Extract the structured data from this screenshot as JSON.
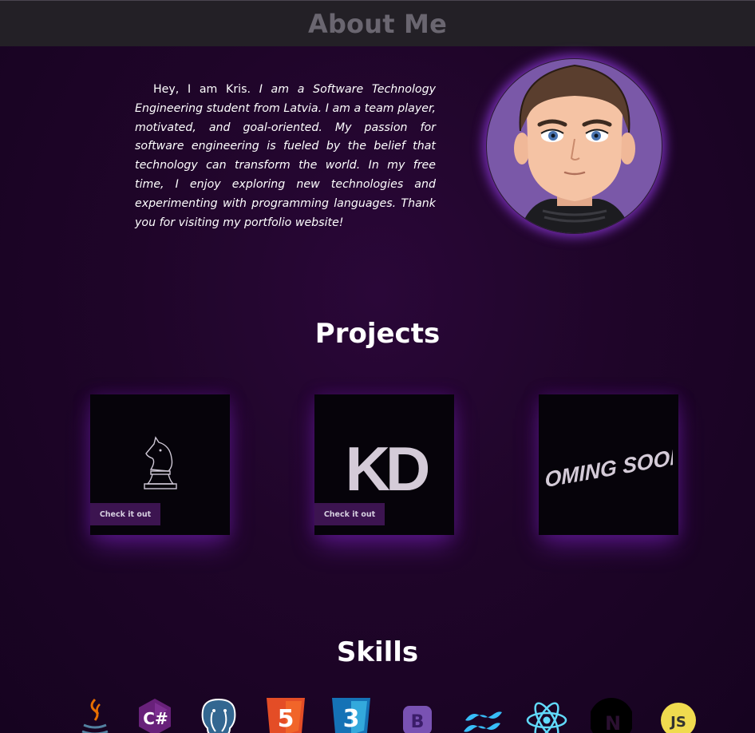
{
  "header": {
    "title": "About Me"
  },
  "about": {
    "bio_lead": "Hey, I am Kris.",
    "bio_rest": "I am a Software Technology Engineering student from Latvia. I am a team player, motivated, and goal-oriented. My passion for software engineering is fueled by the belief that technology can transform the world. In my free time, I enjoy exploring new technologies and experimenting with programming languages. Thank you for visiting my portfolio website!"
  },
  "projects": {
    "title": "Projects",
    "items": [
      {
        "icon": "chess-knight-icon",
        "button_label": "Check it out"
      },
      {
        "icon": "kd-logo-icon",
        "logo_text": "KD",
        "button_label": "Check it out"
      },
      {
        "icon": "coming-soon-icon",
        "logo_text": "COMING SOON"
      }
    ]
  },
  "skills": {
    "title": "Skills",
    "items": [
      {
        "icon": "java-icon"
      },
      {
        "icon": "csharp-icon",
        "text": "C#"
      },
      {
        "icon": "postgresql-icon"
      },
      {
        "icon": "html5-icon",
        "text": "5"
      },
      {
        "icon": "css3-icon",
        "text": "3"
      },
      {
        "icon": "bootstrap-icon",
        "text": "B"
      },
      {
        "icon": "tailwind-icon"
      },
      {
        "icon": "react-icon"
      },
      {
        "icon": "nextjs-icon",
        "text": "N"
      },
      {
        "icon": "javascript-icon",
        "text": "JS"
      }
    ]
  },
  "colors": {
    "background": "#1f0529",
    "header_bg": "#232026",
    "header_text": "#6a6670",
    "avatar_bg": "#7a58a8",
    "glow": "#963ce6",
    "button_bg": "#3c1450"
  }
}
